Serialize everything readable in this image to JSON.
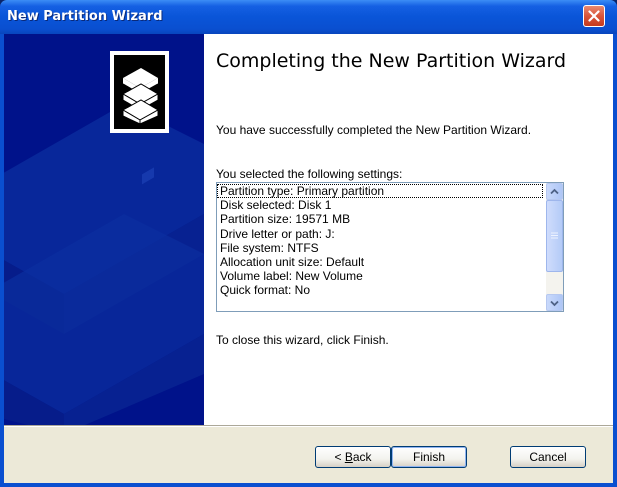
{
  "window": {
    "title": "New Partition Wizard"
  },
  "content": {
    "heading": "Completing the New Partition Wizard",
    "success_message": "You have successfully completed the New Partition Wizard.",
    "settings_label": "You selected the following settings:",
    "settings": [
      "Partition type: Primary partition",
      "Disk selected: Disk 1",
      "Partition size: 19571 MB",
      "Drive letter or path: J:",
      "File system: NTFS",
      "Allocation unit size: Default",
      "Volume label: New Volume",
      "Quick format: No"
    ],
    "close_instruction": "To close this wizard, click Finish."
  },
  "buttons": {
    "back_prefix": "< ",
    "back_mnemonic": "B",
    "back_rest": "ack",
    "finish": "Finish",
    "cancel": "Cancel"
  },
  "icons": {
    "close": "close-icon",
    "wizard": "stacked-disks-icon",
    "scroll_up": "scroll-up-arrow-icon",
    "scroll_down": "scroll-down-arrow-icon"
  },
  "colors": {
    "titlebar": "#0a55d8",
    "side_panel": "#00128a",
    "close_button": "#d9553a",
    "button_face": "#ece9d8"
  }
}
